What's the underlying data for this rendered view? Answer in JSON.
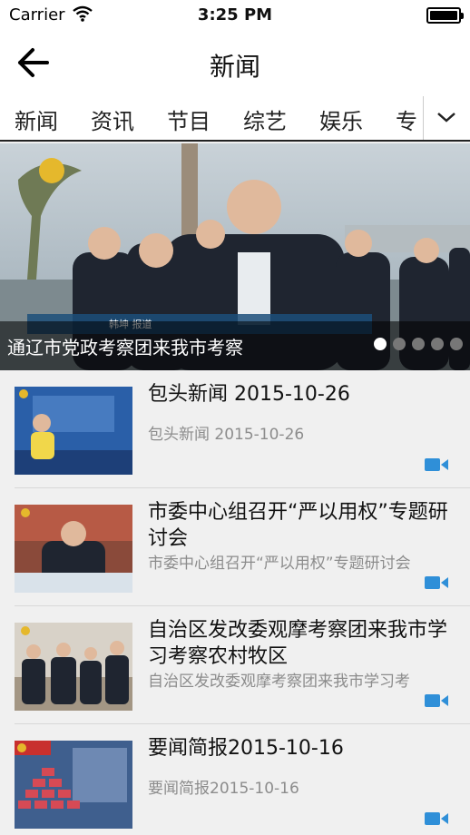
{
  "status_bar": {
    "carrier": "Carrier",
    "time": "3:25 PM"
  },
  "nav": {
    "title": "新闻",
    "back_icon": "arrow-left-icon"
  },
  "tabs": [
    {
      "label": "新闻",
      "active": true
    },
    {
      "label": "资讯",
      "active": false
    },
    {
      "label": "节目",
      "active": false
    },
    {
      "label": "综艺",
      "active": false
    },
    {
      "label": "娱乐",
      "active": false
    },
    {
      "label": "专",
      "active": false
    }
  ],
  "banner": {
    "caption": "通辽市党政考察团来我市考察",
    "overlay_text": "韩坤 报道",
    "slide_count": 5,
    "active_slide": 1
  },
  "news_items": [
    {
      "headline": "包头新闻 2015-10-26",
      "summary": "包头新闻 2015-10-26",
      "media_icon": "video-camera-icon"
    },
    {
      "headline": "市委中心组召开“严以用权”专题研讨会",
      "summary": "市委中心组召开“严以用权”专题研讨会",
      "media_icon": "video-camera-icon"
    },
    {
      "headline": "自治区发改委观摩考察团来我市学习考察农村牧区",
      "summary": "自治区发改委观摩考察团来我市学习考",
      "media_icon": "video-camera-icon"
    },
    {
      "headline": "要闻简报2015-10-16",
      "summary": "要闻简报2015-10-16",
      "media_icon": "video-camera-icon"
    }
  ],
  "colors": {
    "accent_blue": "#2f8fd8",
    "tab_underline": "#222222",
    "summary_gray": "#8c8c8c"
  }
}
